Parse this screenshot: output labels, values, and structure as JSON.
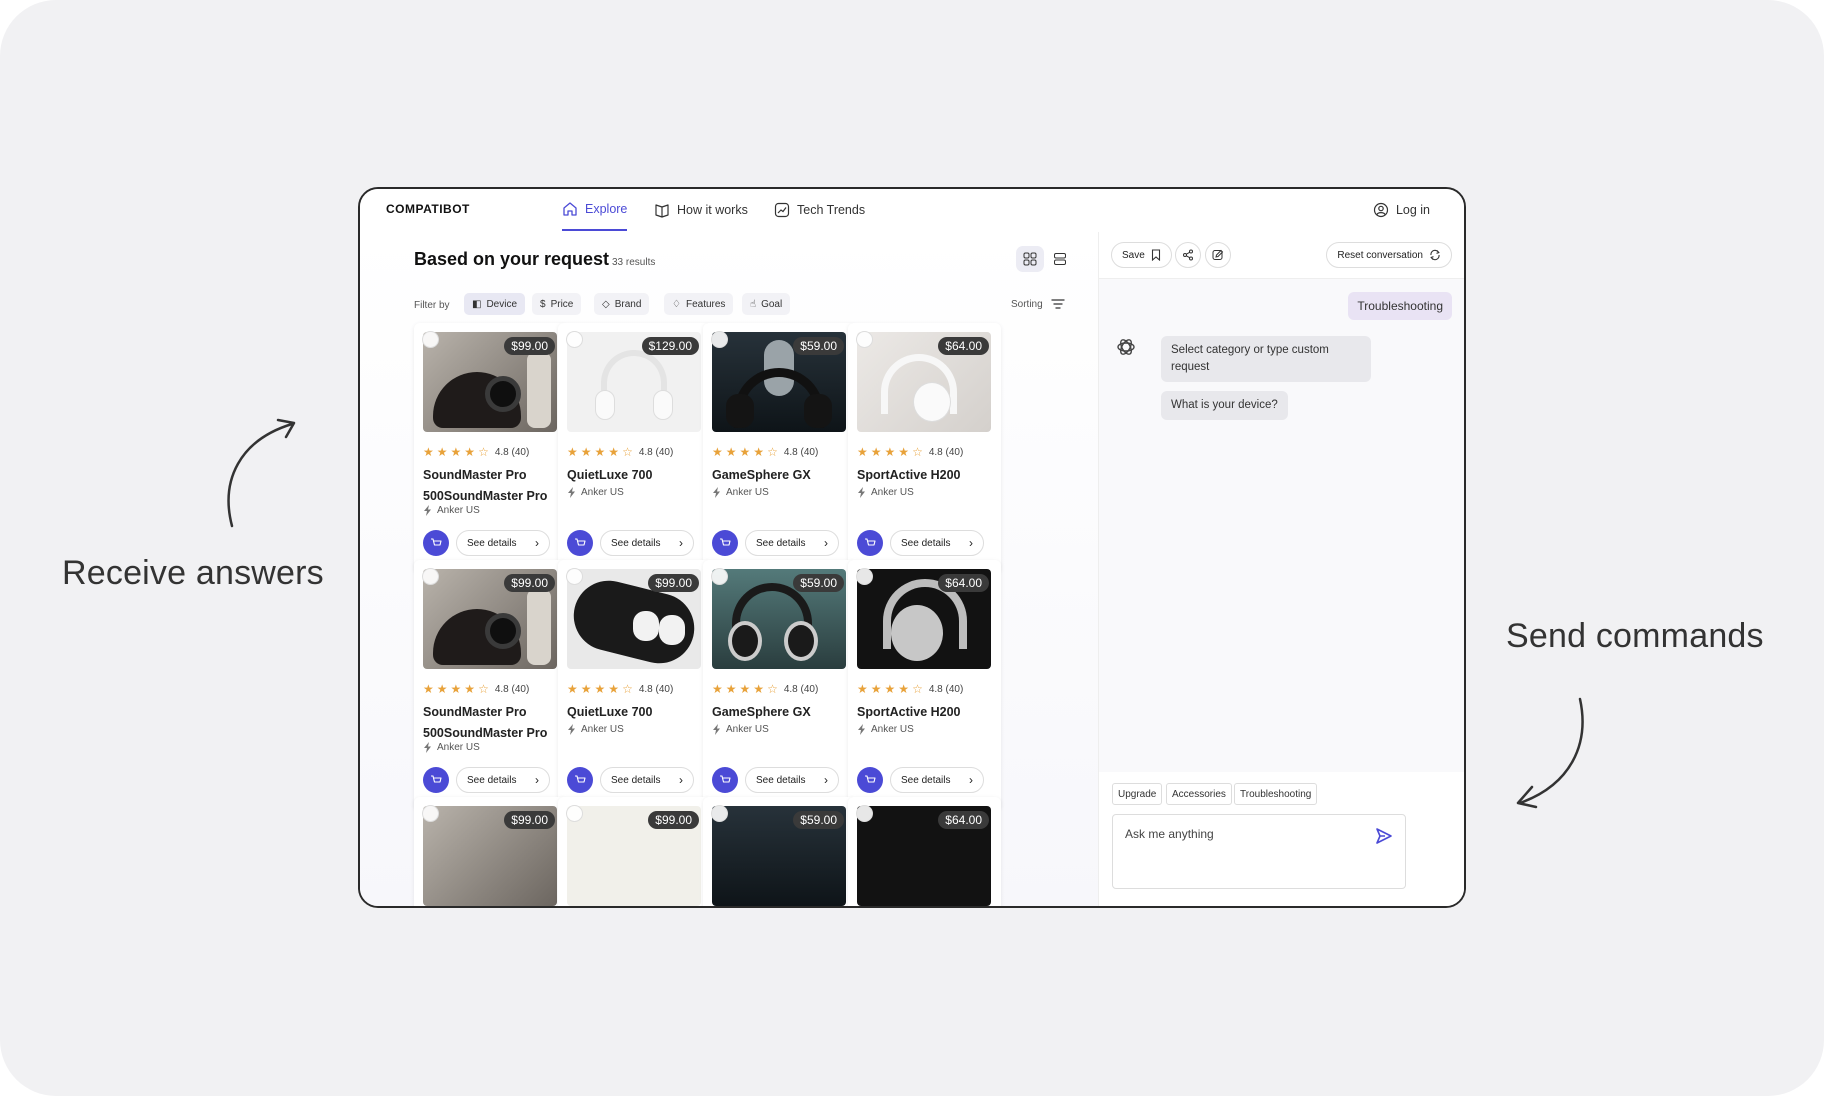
{
  "captions": {
    "left": "Receive answers",
    "right": "Send commands"
  },
  "nav": {
    "logo": "COMPATIBOT",
    "links": [
      {
        "label": "Explore",
        "icon": "home-icon"
      },
      {
        "label": "How it works",
        "icon": "book-icon"
      },
      {
        "label": "Tech Trends",
        "icon": "trend-icon"
      }
    ],
    "login": "Log in"
  },
  "main": {
    "title": "Based on your request",
    "results": "33 results",
    "filter_label": "Filter by",
    "filters": [
      {
        "label": "Device",
        "icon": "device-icon"
      },
      {
        "label": "Price",
        "icon": "dollar-icon"
      },
      {
        "label": "Brand",
        "icon": "diamond-icon"
      },
      {
        "label": "Features",
        "icon": "gem-icon"
      },
      {
        "label": "Goal",
        "icon": "thumb-icon"
      }
    ],
    "sorting": "Sorting"
  },
  "products": [
    {
      "price": "$99.00",
      "rating": "4.8 (40)",
      "name": "SoundMaster Pro 500SoundMaster Pro",
      "brand": "Anker US",
      "details": "See details",
      "stars": 4
    },
    {
      "price": "$129.00",
      "rating": "4.8 (40)",
      "name": "QuietLuxe 700",
      "brand": "Anker US",
      "details": "See details",
      "stars": 4
    },
    {
      "price": "$59.00",
      "rating": "4.8 (40)",
      "name": "GameSphere GX",
      "brand": "Anker US",
      "details": "See details",
      "stars": 4
    },
    {
      "price": "$64.00",
      "rating": "4.8 (40)",
      "name": "SportActive H200",
      "brand": "Anker US",
      "details": "See details",
      "stars": 4
    },
    {
      "price": "$99.00",
      "rating": "4.8 (40)",
      "name": "SoundMaster Pro 500SoundMaster Pro",
      "brand": "Anker US",
      "details": "See details",
      "stars": 4
    },
    {
      "price": "$99.00",
      "rating": "4.8 (40)",
      "name": "QuietLuxe 700",
      "brand": "Anker US",
      "details": "See details",
      "stars": 4
    },
    {
      "price": "$59.00",
      "rating": "4.8 (40)",
      "name": "GameSphere GX",
      "brand": "Anker US",
      "details": "See details",
      "stars": 4
    },
    {
      "price": "$64.00",
      "rating": "4.8 (40)",
      "name": "SportActive H200",
      "brand": "Anker US",
      "details": "See details",
      "stars": 4
    },
    {
      "price": "$99.00"
    },
    {
      "price": "$99.00"
    },
    {
      "price": "$59.00"
    },
    {
      "price": "$64.00"
    }
  ],
  "chat": {
    "save": "Save",
    "reset": "Reset conversation",
    "user_message": "Troubleshooting",
    "bot_messages": [
      "Select category or type custom request",
      "What is your device?"
    ],
    "suggestions": [
      "Upgrade",
      "Accessories",
      "Troubleshooting"
    ],
    "input_placeholder": "Ask me anything"
  },
  "colors": {
    "accent": "#4b4ad6",
    "star": "#e8a23a",
    "user_bubble": "#e9e3f4"
  }
}
